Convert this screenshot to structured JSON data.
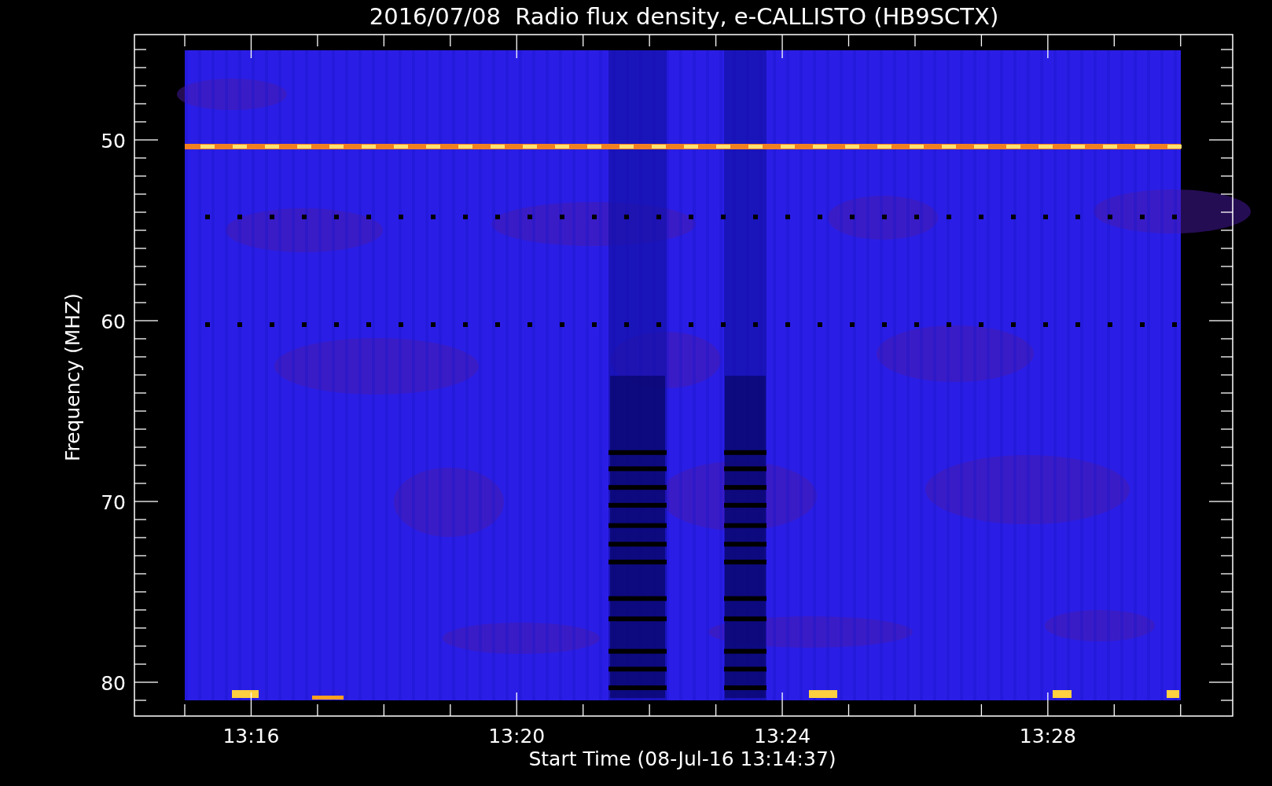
{
  "title": "2016/07/08  Radio flux density, e-CALLISTO (HB9SCTX)",
  "y_axis": {
    "label": "Frequency (MHZ)",
    "ticks": [
      "50",
      "60",
      "70",
      "80"
    ]
  },
  "x_axis": {
    "label": "Start Time (08-Jul-16 13:14:37)",
    "ticks": [
      "13:16",
      "13:20",
      "13:24",
      "13:28"
    ]
  }
}
